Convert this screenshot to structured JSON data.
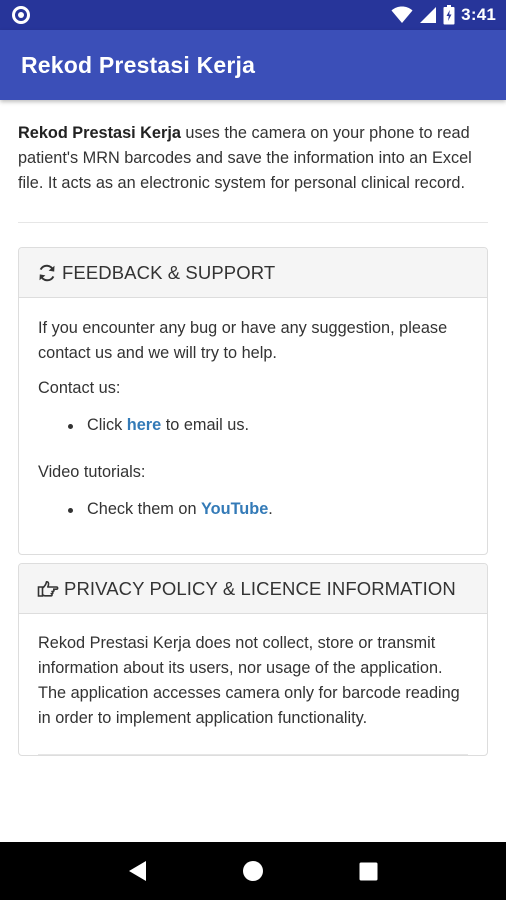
{
  "status_bar": {
    "time": "3:41",
    "icons": [
      "notification-circle-icon",
      "wifi-icon",
      "signal-icon",
      "battery-icon"
    ]
  },
  "app_bar": {
    "title": "Rekod Prestasi Kerja"
  },
  "intro": {
    "app_name": "Rekod Prestasi Kerja",
    "text": " uses the camera on your phone to read patient's MRN barcodes and save the information into an Excel file. It acts as an electronic system for personal clinical record."
  },
  "feedback": {
    "icon": "refresh-icon",
    "title": "FEEDBACK & SUPPORT",
    "description": "If you encounter any bug or have any suggestion, please contact us and we will try to help.",
    "contact_label": "Contact us:",
    "contact_item": {
      "prefix": "Click ",
      "link": "here",
      "suffix": " to email us."
    },
    "video_label": "Video tutorials:",
    "video_item": {
      "prefix": "Check them on ",
      "link": "YouTube",
      "suffix": "."
    }
  },
  "privacy": {
    "icon": "hand-pointing-icon",
    "title": "PRIVACY POLICY & LICENCE INFORMATION",
    "text": "Rekod Prestasi Kerja does not collect, store or transmit information about its users, nor usage of the application. The application accesses camera only for barcode reading in order to implement application functionality."
  },
  "nav_bar": {
    "buttons": [
      "back-icon",
      "home-icon",
      "recents-icon"
    ]
  },
  "colors": {
    "status_bar": "#27359a",
    "app_bar": "#3b4fb8",
    "link": "#337ab7",
    "panel_heading": "#f5f5f5"
  }
}
